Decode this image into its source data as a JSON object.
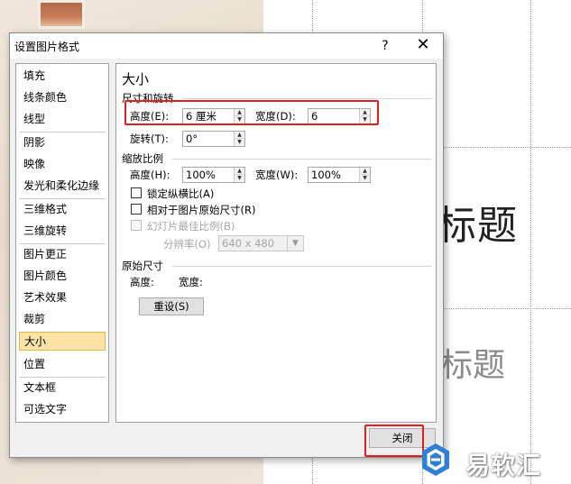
{
  "dialog": {
    "title": "设置图片格式",
    "help_glyph": "?",
    "close_glyph": "✕"
  },
  "nav": {
    "items": [
      {
        "label": "填充"
      },
      {
        "label": "线条颜色"
      },
      {
        "label": "线型"
      },
      {
        "label": "阴影"
      },
      {
        "label": "映像"
      },
      {
        "label": "发光和柔化边缘"
      },
      {
        "label": "三维格式"
      },
      {
        "label": "三维旋转"
      },
      {
        "label": "图片更正"
      },
      {
        "label": "图片颜色"
      },
      {
        "label": "艺术效果"
      },
      {
        "label": "裁剪"
      },
      {
        "label": "大小",
        "selected": true
      },
      {
        "label": "位置"
      },
      {
        "label": "文本框"
      },
      {
        "label": "可选文字"
      }
    ]
  },
  "panel": {
    "heading": "大小",
    "size_rotate": {
      "section_label": "尺寸和旋转",
      "height_label": "高度(E):",
      "height_value": "6 厘米",
      "width_label": "宽度(D):",
      "width_value": "6",
      "rotation_label": "旋转(T):",
      "rotation_value": "0°"
    },
    "scale": {
      "section_label": "缩放比例",
      "height_label": "高度(H):",
      "height_value": "100%",
      "width_label": "宽度(W):",
      "width_value": "100%",
      "lock_aspect_label": "锁定纵横比(A)",
      "lock_aspect_checked": false,
      "relative_original_label": "相对于图片原始尺寸(R)",
      "relative_original_checked": false,
      "best_scale_label": "幻灯片最佳比例(B)",
      "best_scale_enabled": false,
      "resolution_label": "分辨率(O)",
      "resolution_value": "640 x 480"
    },
    "original_size": {
      "section_label": "原始尺寸",
      "height_label": "高度:",
      "width_label": "宽度:",
      "reset_label": "重设(S)"
    }
  },
  "footer": {
    "close_label": "关闭"
  },
  "slide": {
    "title_text": "标题",
    "subtitle_text": "标题"
  },
  "watermark": {
    "text": "易软汇"
  },
  "colors": {
    "highlight": "#e02020",
    "selected_nav": "#fbe3a5",
    "watermark_blue": "#2f7fd6"
  }
}
